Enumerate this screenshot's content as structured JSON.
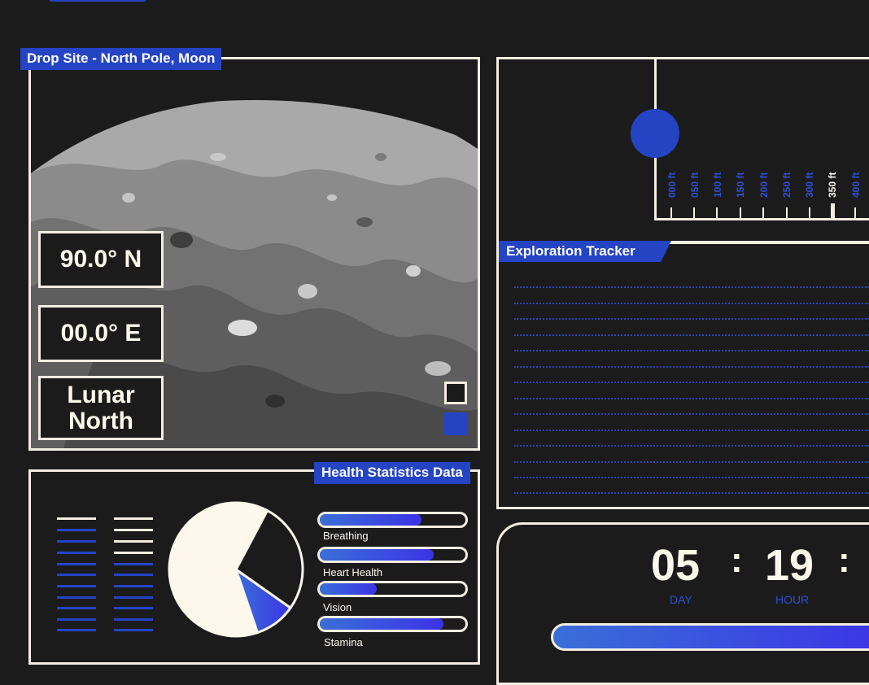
{
  "drop_site": {
    "title": "Drop Site - North Pole, Moon",
    "latitude": "90.0° N",
    "longitude": "00.0° E",
    "region_line1": "Lunar",
    "region_line2": "North"
  },
  "depth_ruler": {
    "labels": [
      "000 ft",
      "050 ft",
      "100 ft",
      "150 ft",
      "200 ft",
      "250 ft",
      "300 ft",
      "350 ft",
      "400 ft"
    ],
    "active_label": "350 ft"
  },
  "exploration": {
    "title": "Exploration Tracker"
  },
  "health": {
    "title": "Health Statistics Data",
    "bars": [
      {
        "label": "Breathing",
        "value": 0.7
      },
      {
        "label": "Heart Health",
        "value": 0.78
      },
      {
        "label": "Vision",
        "value": 0.39
      },
      {
        "label": "Stamina",
        "value": 0.85
      }
    ],
    "pie_slices": [
      0.63,
      0.27,
      0.1
    ]
  },
  "timer": {
    "day": "05",
    "hour": "19",
    "sep": ":",
    "day_label": "DAY",
    "hour_label": "HOUR"
  },
  "colors": {
    "accent": "#2544c4",
    "cream": "#fdf7ec",
    "background": "#1b1b1c"
  }
}
